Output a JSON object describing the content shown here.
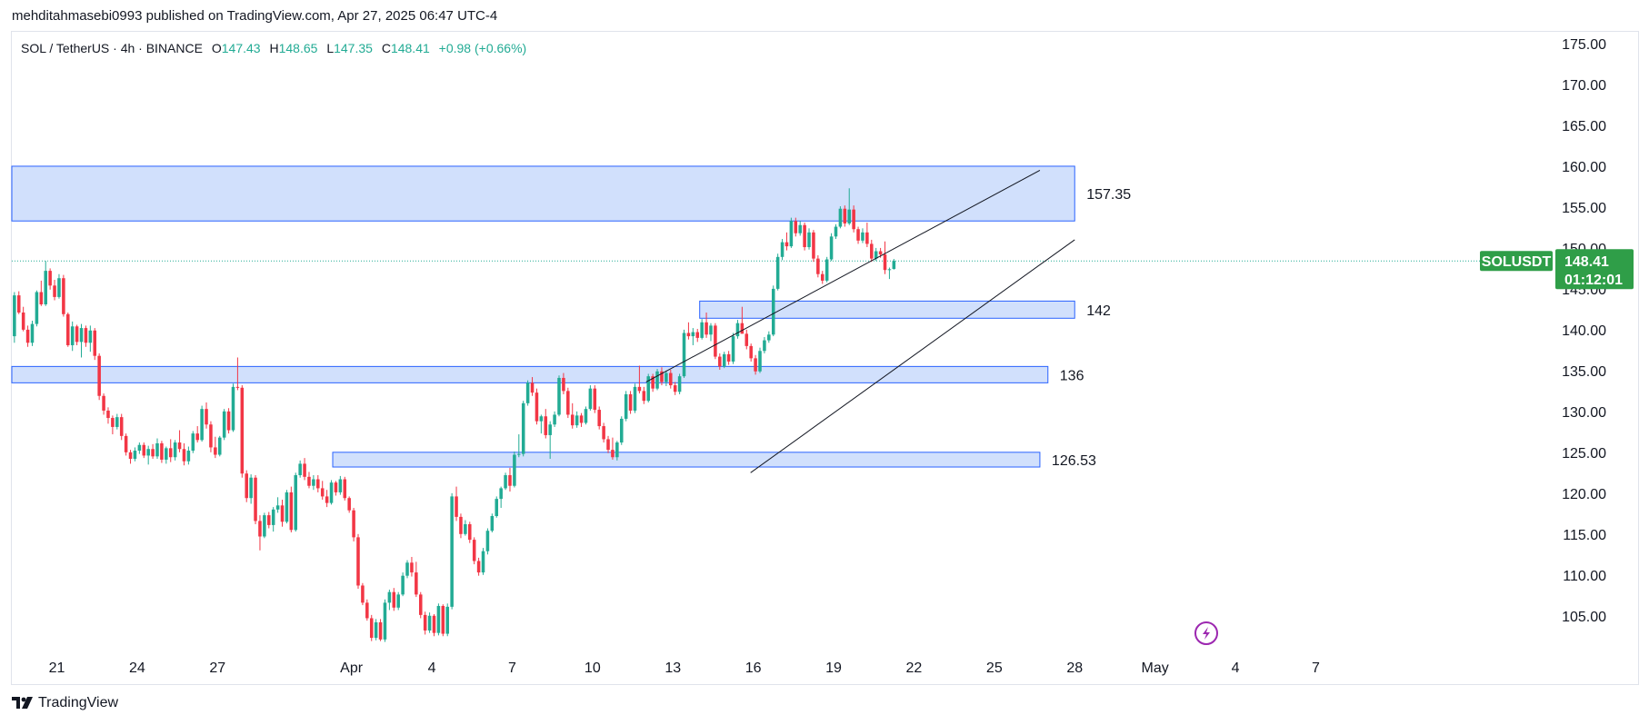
{
  "publisher_line": "mehditahmasebi0993 published on TradingView.com, Apr 27, 2025 06:47 UTC-4",
  "legend": {
    "symbol": "SOL / TetherUS · 4h · BINANCE",
    "o_label": "O",
    "o_value": "147.43",
    "h_label": "H",
    "h_value": "148.65",
    "l_label": "L",
    "l_value": "147.35",
    "c_label": "C",
    "c_value": "148.41",
    "change": "+0.98 (+0.66%)"
  },
  "price_badge": {
    "symbol": "SOLUSDT",
    "price": "148.41",
    "countdown": "01:12:01"
  },
  "footer": {
    "brand": "TradingView"
  },
  "colors": {
    "up": "#22ab94",
    "down": "#f23645",
    "zone_fill": "#d1e0fc",
    "zone_border": "#2962ff",
    "badge": "#2f9e48"
  },
  "icons": {
    "logo": "tradingview-logo-icon",
    "alert": "lightning-icon"
  },
  "chart_data": {
    "type": "candlestick",
    "interval": "4h",
    "ylim": [
      100,
      176
    ],
    "y_ticks": [
      "175.00",
      "170.00",
      "165.00",
      "160.00",
      "155.00",
      "150.00",
      "145.00",
      "140.00",
      "135.00",
      "130.00",
      "125.00",
      "120.00",
      "115.00",
      "110.00",
      "105.00"
    ],
    "x_ticks": [
      "21",
      "24",
      "27",
      "Apr",
      "4",
      "7",
      "10",
      "13",
      "16",
      "19",
      "22",
      "25",
      "28",
      "May",
      "4",
      "7"
    ],
    "x_tick_days": [
      21,
      24,
      27,
      32,
      35,
      38,
      41,
      44,
      47,
      50,
      53,
      56,
      59,
      62,
      65,
      68
    ],
    "last_price": 148.41,
    "zones": [
      {
        "label": "157.35",
        "top": 160.0,
        "bottom": 153.3,
        "start_day": 16.0,
        "end_day": 59.0
      },
      {
        "label": "142",
        "top": 143.5,
        "bottom": 141.4,
        "start_day": 45.0,
        "end_day": 59.0
      },
      {
        "label": "136",
        "top": 135.5,
        "bottom": 133.5,
        "start_day": 16.0,
        "end_day": 58.0
      },
      {
        "label": "126.53",
        "top": 125.0,
        "bottom": 123.2,
        "start_day": 31.3,
        "end_day": 57.7
      }
    ],
    "trendlines": [
      {
        "start": [
          43.0,
          133.6
        ],
        "end": [
          57.7,
          159.5
        ]
      },
      {
        "start": [
          46.9,
          122.5
        ],
        "end": [
          59.0,
          151.0
        ]
      }
    ],
    "candles": [
      [
        134.8,
        135.7,
        133.5,
        134.3
      ],
      [
        134.3,
        135.6,
        131.4,
        131.5
      ],
      [
        131.5,
        132.1,
        128.7,
        128.8
      ],
      [
        128.8,
        129.3,
        127.6,
        128.1
      ],
      [
        128.1,
        128.7,
        127.3,
        128.3
      ],
      [
        128.3,
        128.6,
        126.4,
        126.9
      ],
      [
        126.9,
        127.3,
        125.3,
        126.2
      ],
      [
        126.2,
        128.9,
        126.0,
        128.7
      ],
      [
        128.7,
        129.1,
        127.5,
        128.1
      ],
      [
        128.1,
        129.6,
        127.7,
        129.4
      ],
      [
        129.4,
        130.7,
        129.1,
        130.2
      ],
      [
        130.2,
        130.7,
        129.1,
        129.6
      ],
      [
        129.6,
        130.1,
        128.4,
        128.6
      ],
      [
        128.6,
        130.7,
        128.4,
        130.4
      ],
      [
        130.4,
        130.9,
        128.4,
        128.7
      ],
      [
        128.7,
        131.2,
        128.5,
        131.0
      ],
      [
        131.0,
        133.3,
        130.8,
        133.1
      ],
      [
        133.1,
        133.5,
        130.0,
        130.5
      ],
      [
        130.5,
        133.5,
        130.3,
        133.0
      ],
      [
        133.0,
        139.5,
        132.8,
        139.2
      ],
      [
        139.2,
        144.6,
        138.4,
        144.2
      ],
      [
        144.2,
        144.7,
        141.9,
        142.1
      ],
      [
        142.1,
        142.8,
        139.8,
        140.0
      ],
      [
        140.0,
        140.5,
        137.9,
        138.4
      ],
      [
        138.4,
        141.1,
        138.0,
        140.7
      ],
      [
        140.7,
        144.8,
        140.4,
        144.6
      ],
      [
        144.6,
        146.0,
        142.9,
        143.1
      ],
      [
        143.1,
        148.4,
        142.9,
        147.2
      ],
      [
        147.2,
        147.5,
        144.9,
        145.4
      ],
      [
        145.4,
        146.1,
        143.6,
        144.0
      ],
      [
        144.0,
        146.8,
        143.8,
        146.3
      ],
      [
        146.3,
        146.7,
        141.6,
        141.9
      ],
      [
        141.9,
        142.1,
        137.9,
        138.1
      ],
      [
        138.1,
        141.0,
        137.4,
        140.4
      ],
      [
        140.4,
        140.6,
        138.1,
        138.5
      ],
      [
        138.5,
        140.7,
        136.6,
        140.2
      ],
      [
        140.2,
        140.5,
        137.9,
        138.4
      ],
      [
        138.4,
        140.5,
        137.3,
        139.9
      ],
      [
        139.9,
        140.2,
        136.3,
        136.8
      ],
      [
        136.8,
        137.1,
        131.4,
        131.9
      ],
      [
        131.9,
        132.2,
        129.6,
        130.1
      ],
      [
        130.1,
        130.5,
        128.5,
        129.2
      ],
      [
        129.2,
        129.5,
        127.2,
        128.1
      ],
      [
        128.1,
        129.7,
        127.8,
        129.3
      ],
      [
        129.3,
        129.7,
        126.5,
        127.0
      ],
      [
        127.0,
        127.3,
        124.6,
        125.0
      ],
      [
        125.0,
        125.3,
        123.6,
        124.2
      ],
      [
        124.2,
        125.6,
        123.9,
        125.2
      ],
      [
        125.2,
        126.2,
        124.8,
        125.9
      ],
      [
        125.9,
        126.2,
        124.3,
        124.6
      ],
      [
        124.6,
        125.8,
        123.5,
        125.4
      ],
      [
        125.4,
        126.0,
        124.2,
        124.5
      ],
      [
        124.5,
        126.7,
        124.2,
        126.1
      ],
      [
        126.1,
        126.4,
        123.7,
        124.1
      ],
      [
        124.1,
        125.7,
        123.6,
        125.5
      ],
      [
        125.5,
        126.6,
        123.8,
        124.4
      ],
      [
        124.4,
        126.5,
        124.0,
        126.2
      ],
      [
        126.2,
        127.7,
        125.0,
        125.4
      ],
      [
        125.4,
        126.1,
        123.4,
        123.9
      ],
      [
        123.9,
        125.7,
        123.5,
        125.2
      ],
      [
        125.2,
        127.6,
        124.9,
        127.3
      ],
      [
        127.3,
        128.2,
        126.2,
        126.5
      ],
      [
        126.5,
        130.7,
        126.3,
        130.3
      ],
      [
        130.3,
        131.1,
        127.9,
        128.4
      ],
      [
        128.4,
        128.8,
        125.0,
        125.6
      ],
      [
        125.6,
        126.9,
        124.3,
        124.7
      ],
      [
        124.7,
        127.0,
        124.5,
        126.8
      ],
      [
        126.8,
        130.3,
        126.5,
        130.0
      ],
      [
        130.0,
        130.4,
        127.3,
        127.7
      ],
      [
        127.7,
        133.4,
        127.5,
        133.0
      ],
      [
        133.0,
        136.6,
        132.6,
        132.9
      ],
      [
        132.9,
        133.2,
        121.9,
        122.4
      ],
      [
        122.4,
        122.8,
        118.9,
        119.4
      ],
      [
        119.4,
        122.3,
        118.7,
        121.9
      ],
      [
        121.9,
        122.2,
        116.2,
        116.6
      ],
      [
        116.6,
        117.3,
        113.0,
        114.7
      ],
      [
        114.7,
        117.6,
        114.5,
        117.3
      ],
      [
        117.3,
        117.7,
        115.7,
        116.1
      ],
      [
        116.1,
        118.3,
        115.3,
        118.0
      ],
      [
        118.0,
        119.5,
        117.6,
        118.5
      ],
      [
        118.5,
        119.2,
        115.9,
        116.5
      ],
      [
        116.5,
        120.4,
        116.3,
        120.1
      ],
      [
        120.1,
        120.8,
        115.2,
        115.5
      ],
      [
        115.5,
        122.5,
        115.3,
        122.2
      ],
      [
        122.2,
        124.0,
        121.9,
        123.6
      ],
      [
        123.6,
        124.3,
        121.6,
        122.0
      ],
      [
        122.0,
        122.6,
        120.6,
        120.9
      ],
      [
        120.9,
        122.2,
        120.4,
        121.7
      ],
      [
        121.7,
        122.2,
        120.1,
        120.6
      ],
      [
        120.6,
        121.5,
        119.2,
        119.6
      ],
      [
        119.6,
        120.4,
        118.3,
        118.8
      ],
      [
        118.8,
        121.6,
        118.6,
        121.3
      ],
      [
        121.3,
        121.5,
        119.7,
        120.1
      ],
      [
        120.1,
        122.1,
        119.8,
        121.7
      ],
      [
        121.7,
        122.0,
        119.1,
        119.4
      ],
      [
        119.4,
        119.6,
        117.6,
        117.9
      ],
      [
        117.9,
        118.2,
        114.1,
        114.6
      ],
      [
        114.6,
        115.0,
        108.3,
        108.7
      ],
      [
        108.7,
        109.0,
        106.3,
        106.6
      ],
      [
        106.6,
        107.0,
        104.4,
        104.7
      ],
      [
        104.7,
        105.1,
        101.9,
        102.3
      ],
      [
        102.3,
        104.6,
        102.0,
        104.2
      ],
      [
        104.2,
        104.6,
        101.9,
        102.1
      ],
      [
        102.1,
        107.0,
        101.8,
        106.6
      ],
      [
        106.6,
        108.2,
        105.7,
        107.9
      ],
      [
        107.9,
        108.4,
        105.6,
        106.0
      ],
      [
        106.0,
        107.9,
        105.7,
        107.6
      ],
      [
        107.6,
        110.3,
        107.4,
        109.9
      ],
      [
        109.9,
        111.8,
        109.6,
        111.5
      ],
      [
        111.5,
        112.2,
        109.8,
        110.3
      ],
      [
        110.3,
        111.6,
        107.3,
        107.6
      ],
      [
        107.6,
        107.9,
        104.7,
        105.1
      ],
      [
        105.1,
        105.5,
        102.7,
        103.2
      ],
      [
        103.2,
        105.4,
        102.9,
        105.0
      ],
      [
        105.0,
        105.2,
        102.5,
        102.9
      ],
      [
        102.9,
        106.5,
        102.6,
        106.2
      ],
      [
        106.2,
        106.4,
        102.5,
        102.8
      ],
      [
        102.8,
        106.5,
        102.5,
        106.1
      ],
      [
        106.1,
        120.0,
        105.8,
        119.6
      ],
      [
        119.6,
        120.8,
        116.6,
        117.1
      ],
      [
        117.1,
        117.5,
        114.5,
        115.0
      ],
      [
        115.0,
        116.7,
        114.8,
        116.2
      ],
      [
        116.2,
        116.5,
        113.9,
        114.3
      ],
      [
        114.3,
        114.6,
        111.3,
        111.7
      ],
      [
        111.7,
        112.1,
        109.9,
        110.3
      ],
      [
        110.3,
        113.3,
        110.0,
        112.9
      ],
      [
        112.9,
        115.7,
        112.5,
        115.4
      ],
      [
        115.4,
        117.5,
        115.2,
        117.2
      ],
      [
        117.2,
        119.6,
        117.0,
        119.3
      ],
      [
        119.3,
        120.8,
        118.2,
        120.6
      ],
      [
        120.6,
        122.5,
        120.4,
        122.2
      ],
      [
        122.2,
        123.1,
        120.2,
        120.9
      ],
      [
        120.9,
        125.1,
        120.7,
        124.7
      ],
      [
        124.7,
        127.2,
        124.4,
        124.8
      ],
      [
        124.8,
        131.3,
        124.5,
        131.0
      ],
      [
        131.0,
        133.8,
        130.7,
        133.5
      ],
      [
        133.5,
        134.2,
        131.9,
        132.3
      ],
      [
        132.3,
        132.8,
        128.4,
        128.8
      ],
      [
        128.8,
        129.6,
        127.3,
        129.4
      ],
      [
        129.4,
        130.3,
        126.7,
        127.1
      ],
      [
        127.1,
        128.8,
        124.2,
        128.4
      ],
      [
        128.4,
        130.0,
        128.1,
        129.6
      ],
      [
        129.6,
        134.4,
        129.4,
        134.1
      ],
      [
        134.1,
        134.7,
        132.1,
        132.5
      ],
      [
        132.5,
        132.9,
        129.2,
        129.6
      ],
      [
        129.6,
        131.0,
        127.9,
        128.3
      ],
      [
        128.3,
        130.0,
        128.0,
        129.5
      ],
      [
        129.5,
        129.8,
        128.1,
        128.6
      ],
      [
        128.6,
        130.6,
        128.4,
        130.3
      ],
      [
        130.3,
        133.2,
        130.1,
        132.8
      ],
      [
        132.8,
        133.2,
        129.8,
        130.2
      ],
      [
        130.2,
        130.6,
        127.8,
        128.2
      ],
      [
        128.2,
        128.6,
        126.2,
        126.6
      ],
      [
        126.6,
        127.0,
        124.9,
        125.3
      ],
      [
        125.3,
        126.8,
        124.1,
        124.4
      ],
      [
        124.4,
        126.4,
        124.0,
        126.2
      ],
      [
        126.2,
        129.4,
        125.9,
        129.1
      ],
      [
        129.1,
        132.5,
        128.8,
        132.1
      ],
      [
        132.1,
        132.5,
        129.7,
        130.1
      ],
      [
        130.1,
        133.4,
        129.8,
        133.0
      ],
      [
        133.0,
        135.6,
        132.2,
        132.5
      ],
      [
        132.5,
        133.0,
        130.9,
        131.3
      ],
      [
        131.3,
        134.6,
        131.1,
        134.3
      ],
      [
        134.3,
        134.6,
        132.4,
        132.8
      ],
      [
        132.8,
        135.2,
        132.6,
        134.9
      ],
      [
        134.9,
        135.4,
        133.2,
        133.6
      ],
      [
        133.6,
        135.0,
        133.1,
        134.7
      ],
      [
        134.7,
        135.1,
        132.8,
        133.2
      ],
      [
        133.2,
        133.6,
        132.0,
        132.4
      ],
      [
        132.4,
        134.6,
        132.1,
        134.3
      ],
      [
        134.3,
        140.0,
        134.1,
        139.6
      ],
      [
        139.6,
        140.9,
        138.8,
        139.2
      ],
      [
        139.2,
        140.2,
        138.1,
        139.7
      ],
      [
        139.7,
        140.1,
        138.5,
        139.0
      ],
      [
        139.0,
        141.3,
        138.8,
        140.9
      ],
      [
        140.9,
        142.1,
        139.0,
        139.4
      ],
      [
        139.4,
        140.8,
        138.6,
        140.5
      ],
      [
        140.5,
        140.8,
        136.4,
        136.7
      ],
      [
        136.7,
        137.1,
        135.1,
        135.5
      ],
      [
        135.5,
        137.3,
        135.3,
        137.0
      ],
      [
        137.0,
        137.4,
        135.7,
        136.1
      ],
      [
        136.1,
        139.6,
        135.8,
        139.2
      ],
      [
        139.2,
        141.2,
        138.9,
        140.8
      ],
      [
        140.8,
        142.8,
        140.6,
        139.5
      ],
      [
        139.5,
        140.0,
        137.6,
        138.0
      ],
      [
        138.0,
        138.3,
        136.1,
        136.5
      ],
      [
        136.5,
        136.9,
        134.5,
        134.9
      ],
      [
        134.9,
        137.8,
        134.7,
        137.4
      ],
      [
        137.4,
        139.1,
        137.1,
        138.7
      ],
      [
        138.7,
        139.8,
        138.4,
        139.4
      ],
      [
        139.4,
        145.4,
        139.2,
        145.0
      ],
      [
        145.0,
        149.3,
        144.8,
        148.9
      ],
      [
        148.9,
        151.1,
        148.5,
        150.7
      ],
      [
        150.7,
        151.9,
        149.7,
        150.2
      ],
      [
        150.2,
        153.7,
        150.0,
        153.3
      ],
      [
        153.3,
        153.7,
        151.4,
        151.8
      ],
      [
        151.8,
        153.3,
        151.5,
        152.8
      ],
      [
        152.8,
        153.1,
        149.7,
        150.1
      ],
      [
        150.1,
        152.4,
        149.8,
        151.9
      ],
      [
        151.9,
        152.2,
        148.3,
        148.7
      ],
      [
        148.7,
        149.1,
        146.4,
        146.8
      ],
      [
        146.8,
        147.2,
        145.6,
        146.0
      ],
      [
        146.0,
        148.9,
        145.8,
        148.6
      ],
      [
        148.6,
        151.8,
        148.4,
        151.4
      ],
      [
        151.4,
        152.9,
        151.1,
        152.6
      ],
      [
        152.6,
        155.1,
        152.4,
        154.8
      ],
      [
        154.8,
        155.2,
        152.6,
        153.0
      ],
      [
        153.0,
        157.3,
        152.8,
        154.7
      ],
      [
        154.7,
        155.2,
        151.9,
        152.3
      ],
      [
        152.3,
        152.6,
        150.5,
        150.9
      ],
      [
        150.9,
        152.4,
        150.6,
        151.9
      ],
      [
        151.9,
        153.1,
        150.1,
        150.5
      ],
      [
        150.5,
        151.0,
        148.3,
        148.7
      ],
      [
        148.7,
        150.0,
        148.4,
        149.6
      ],
      [
        149.6,
        150.0,
        148.8,
        149.2
      ],
      [
        149.2,
        150.8,
        146.8,
        147.3
      ],
      [
        147.3,
        147.6,
        146.2,
        147.4
      ],
      [
        147.43,
        148.65,
        147.35,
        148.41
      ]
    ]
  }
}
